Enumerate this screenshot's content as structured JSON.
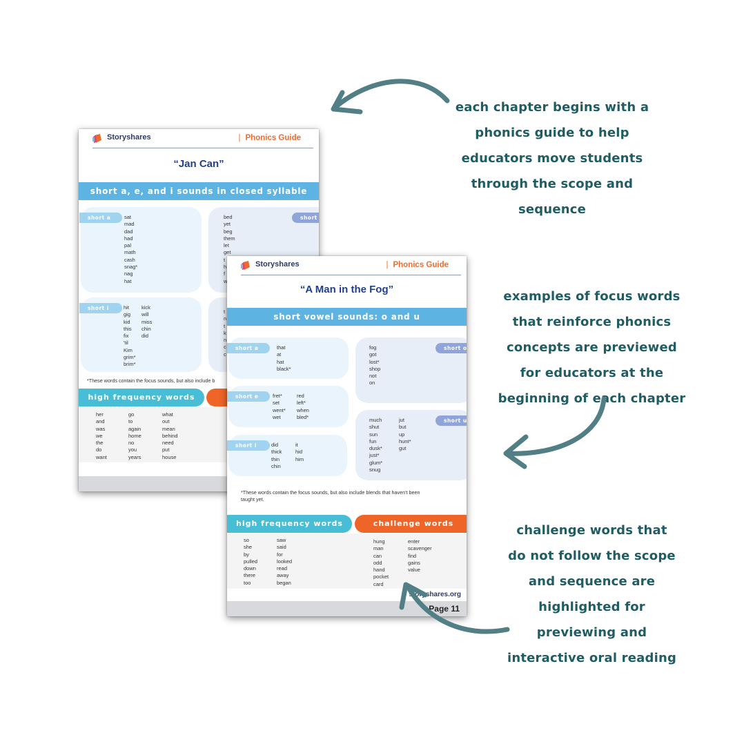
{
  "colors": {
    "annotation_text": "#1f5c63",
    "arrow": "#527f86",
    "brand_navy": "#2b3a67",
    "title_blue": "#213f8f",
    "guide_orange": "#ef6b2d",
    "banner_blue": "#5db4e3",
    "hf_teal": "#48bed6",
    "challenge_orange": "#ef6528"
  },
  "back_page": {
    "brand": "Storyshares",
    "guide_label": "Phonics Guide",
    "title": "“Jan Can”",
    "banner": "short a, e, and i sounds in closed syllable words",
    "groups": [
      {
        "label": "short a",
        "columns": [
          [
            "sat",
            "mad",
            "dad",
            "had",
            "pal",
            "math",
            "cash",
            "snag*",
            "nag",
            "hat"
          ]
        ]
      },
      {
        "label": "short e",
        "columns": [
          [
            "bed",
            "yet",
            "beg",
            "them",
            "let",
            "get",
            "t",
            "h",
            "f",
            "w"
          ]
        ]
      },
      {
        "label": "short i",
        "columns": [
          [
            "hit",
            "gig",
            "kid",
            "this",
            "fix",
            "'til",
            "Kim",
            "grim*",
            "brim*"
          ],
          [
            "kick",
            "will",
            "miss",
            "chin",
            "did"
          ]
        ]
      },
      {
        "label": "",
        "columns": [
          [
            "t",
            "n",
            "t",
            "k",
            "n",
            "c",
            "c"
          ]
        ]
      }
    ],
    "footnote": "*These words contain the focus sounds, but also include b",
    "hf_label": "high frequency words",
    "hf_columns": [
      [
        "her",
        "and",
        "was",
        "we",
        "the",
        "do",
        "want"
      ],
      [
        "go",
        "to",
        "again",
        "home",
        "no",
        "you",
        "years"
      ],
      [
        "what",
        "out",
        "mean",
        "behind",
        "need",
        "put",
        "house"
      ]
    ]
  },
  "front_page": {
    "brand": "Storyshares",
    "guide_label": "Phonics Guide",
    "title": "“A Man in the Fog”",
    "banner": "short vowel sounds: o and u",
    "groups_left": [
      {
        "label": "short a",
        "columns": [
          [
            "that",
            "at",
            "hat",
            "black*"
          ]
        ]
      },
      {
        "label": "short e",
        "columns": [
          [
            "fret*",
            "set",
            "went*",
            "wet"
          ],
          [
            "red",
            "left*",
            "when",
            "bled*"
          ]
        ]
      },
      {
        "label": "short i",
        "columns": [
          [
            "did",
            "thick",
            "thin",
            "chin"
          ],
          [
            "it",
            "hid",
            "him"
          ]
        ]
      }
    ],
    "groups_right": [
      {
        "label": "short o",
        "columns": [
          [
            "fog",
            "got",
            "lost*",
            "shop",
            "not",
            "on"
          ]
        ]
      },
      {
        "label": "short u",
        "columns": [
          [
            "much",
            "shut",
            "sun",
            "fun",
            "dusk*",
            "just*",
            "glum*",
            "snug"
          ],
          [
            "jut",
            "but",
            "up",
            "hunt*",
            "gut"
          ]
        ]
      }
    ],
    "footnote_line1": "*These words contain the focus sounds, but also include blends that haven't been",
    "footnote_line2": "taught yet.",
    "hf_label": "high frequency words",
    "challenge_label": "challenge words",
    "hf_columns": [
      [
        "so",
        "she",
        "by",
        "pulled",
        "down",
        "there",
        "too"
      ],
      [
        "saw",
        "said",
        "for",
        "looked",
        "read",
        "away",
        "began"
      ]
    ],
    "challenge_columns": [
      [
        "hung",
        "man",
        "can",
        "odd",
        "hand",
        "pocket",
        "card"
      ],
      [
        "enter",
        "scavenger",
        "find",
        "gains",
        "value"
      ]
    ],
    "site": "storyshares.org",
    "page_label": "Page 11"
  },
  "annotations": [
    {
      "lines": [
        "each chapter begins with a",
        "phonics guide to help",
        "educators move students",
        "through the scope and",
        "sequence"
      ]
    },
    {
      "lines": [
        "examples of focus words",
        "that reinforce phonics",
        "concepts are previewed",
        "for educators at the",
        "beginning of each chapter"
      ]
    },
    {
      "lines": [
        "challenge words that",
        "do not follow the scope",
        "and sequence are",
        "highlighted for",
        "previewing and",
        "interactive oral reading"
      ]
    }
  ]
}
